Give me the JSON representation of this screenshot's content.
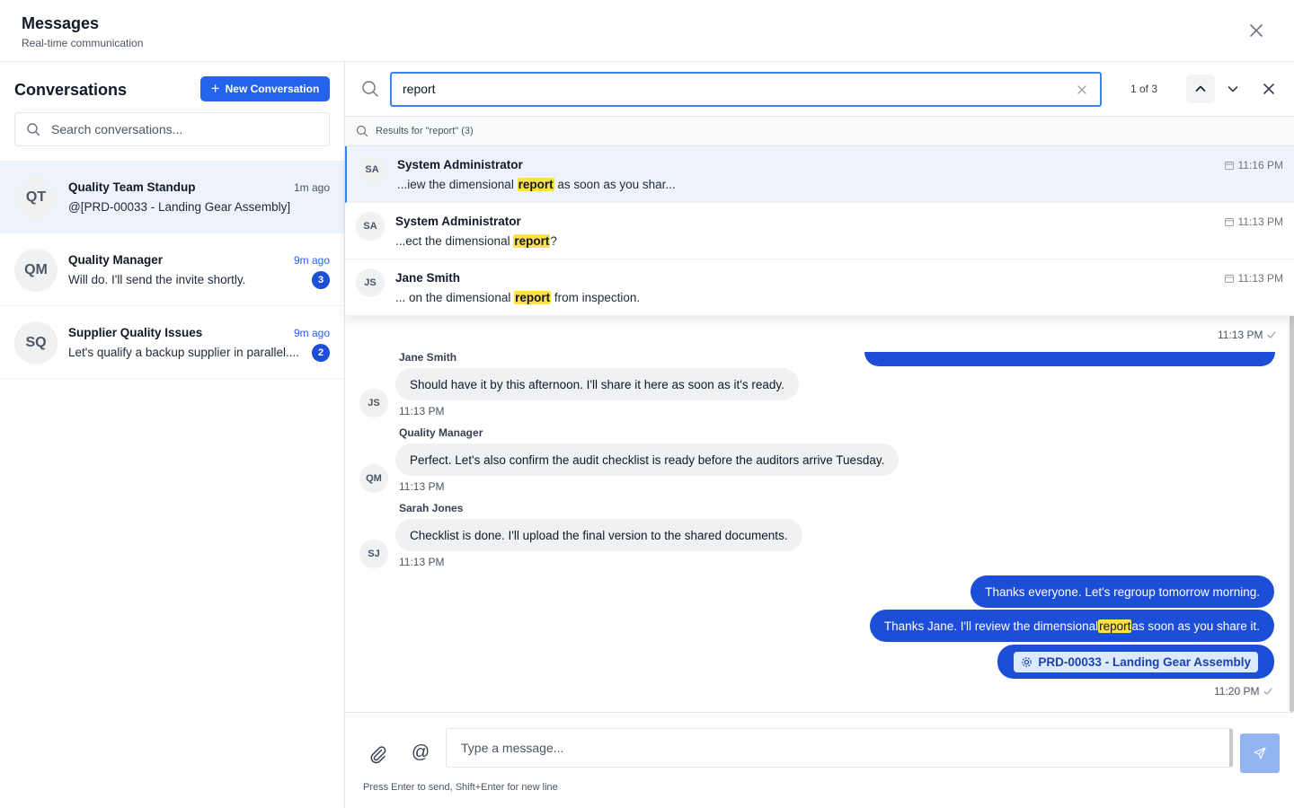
{
  "header": {
    "title": "Messages",
    "subtitle": "Real-time communication"
  },
  "sidebar": {
    "title": "Conversations",
    "new_button": "New Conversation",
    "search_placeholder": "Search conversations...",
    "conversations": [
      {
        "initials": "QT",
        "name": "Quality Team Standup",
        "time": "1m ago",
        "preview": "@[PRD-00033 - Landing Gear Assembly]",
        "unread": null
      },
      {
        "initials": "QM",
        "name": "Quality Manager",
        "time": "9m ago",
        "preview": "Will do. I'll send the invite shortly.",
        "unread": "3"
      },
      {
        "initials": "SQ",
        "name": "Supplier Quality Issues",
        "time": "9m ago",
        "preview": "Let's qualify a backup supplier in parallel....",
        "unread": "2"
      }
    ]
  },
  "search": {
    "query": "report",
    "match_count": "1 of 3",
    "results_label": "Results for \"report\" (3)",
    "results": [
      {
        "initials": "SA",
        "name": "System Administrator",
        "before": "...iew the dimensional ",
        "match": "report",
        "after": " as soon as you shar...",
        "time": "11:16 PM"
      },
      {
        "initials": "SA",
        "name": "System Administrator",
        "before": "...ect the dimensional ",
        "match": "report",
        "after": "?",
        "time": "11:13 PM"
      },
      {
        "initials": "JS",
        "name": "Jane Smith",
        "before": "... on the dimensional ",
        "match": "report",
        "after": " from inspection.",
        "time": "11:13 PM"
      }
    ]
  },
  "messages": {
    "partial_time": "11:13 PM",
    "incoming": [
      {
        "sender": "Jane Smith",
        "initials": "JS",
        "text": "Should have it by this afternoon. I'll share it here as soon as it's ready.",
        "time": "11:13 PM"
      },
      {
        "sender": "Quality Manager",
        "initials": "QM",
        "text": "Perfect. Let's also confirm the audit checklist is ready before the auditors arrive Tuesday.",
        "time": "11:13 PM"
      },
      {
        "sender": "Sarah Jones",
        "initials": "SJ",
        "text": "Checklist is done. I'll upload the final version to the shared documents.",
        "time": "11:13 PM"
      }
    ],
    "outgoing": {
      "msg1": "Thanks everyone. Let's regroup tomorrow morning.",
      "msg2_before": "Thanks Jane. I'll review the dimensional ",
      "msg2_match": "report",
      "msg2_after": " as soon as you share it.",
      "ref_chip": "PRD-00033 - Landing Gear Assembly",
      "time": "11:20 PM"
    }
  },
  "composer": {
    "placeholder": "Type a message...",
    "hint": "Press Enter to send, Shift+Enter for new line"
  },
  "colors": {
    "accent": "#2563eb",
    "highlight": "#fde047",
    "outgoing_bubble": "#1d4ed8"
  }
}
